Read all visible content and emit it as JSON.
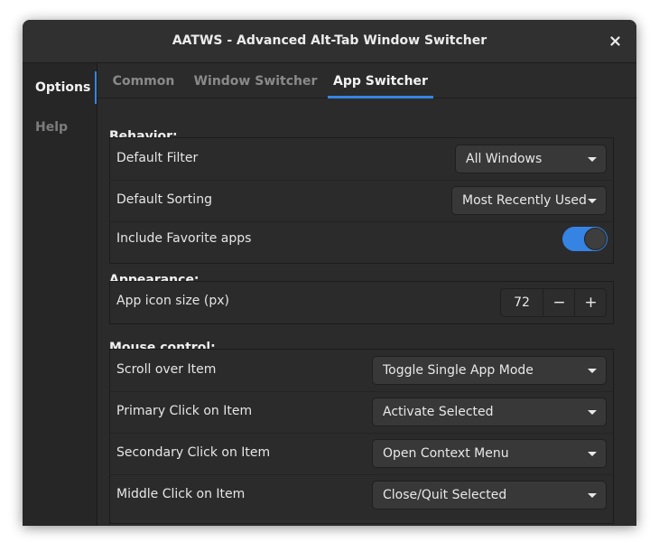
{
  "window": {
    "title": "AATWS - Advanced Alt-Tab Window Switcher",
    "close_icon": "close-icon"
  },
  "sidebar": {
    "items": [
      {
        "label": "Options",
        "active": true
      },
      {
        "label": "Help",
        "active": false
      }
    ]
  },
  "tabs": [
    {
      "label": "Common",
      "active": false
    },
    {
      "label": "Window Switcher",
      "active": false
    },
    {
      "label": "App Switcher",
      "active": true
    }
  ],
  "behavior": {
    "title": "Behavior:",
    "default_filter": {
      "label": "Default Filter",
      "value": "All Windows"
    },
    "default_sorting": {
      "label": "Default Sorting",
      "value": "Most Recently Used"
    },
    "include_favorites": {
      "label": "Include Favorite apps",
      "enabled": true
    }
  },
  "appearance": {
    "title": "Appearance:",
    "icon_size": {
      "label": "App icon size (px)",
      "value": "72",
      "minus": "−",
      "plus": "+"
    }
  },
  "mouse": {
    "title": "Mouse control:",
    "scroll": {
      "label": "Scroll over Item",
      "value": "Toggle Single App Mode"
    },
    "primary": {
      "label": "Primary Click on Item",
      "value": "Activate Selected"
    },
    "secondary": {
      "label": "Secondary Click on Item",
      "value": "Open Context Menu"
    },
    "middle": {
      "label": "Middle Click on Item",
      "value": "Close/Quit Selected"
    }
  },
  "colors": {
    "accent": "#3584e4",
    "background": "#2b2b2b",
    "sidebar": "#262626"
  }
}
